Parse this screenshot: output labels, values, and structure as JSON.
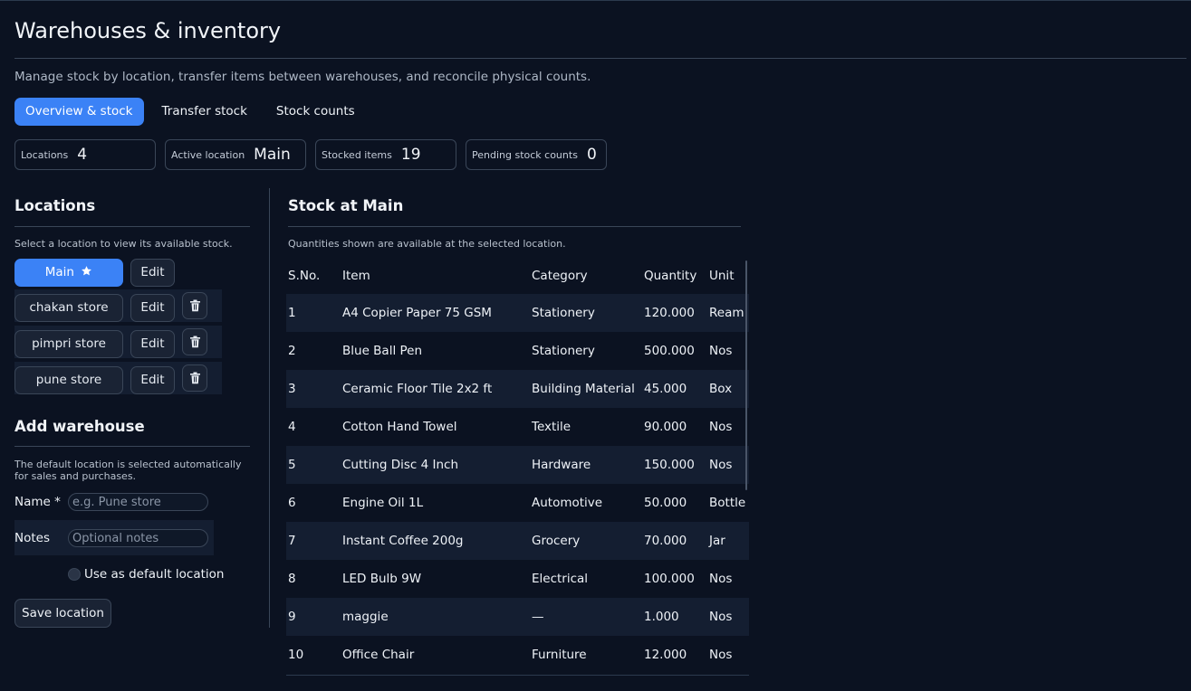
{
  "page": {
    "title": "Warehouses & inventory",
    "subtitle": "Manage stock by location, transfer items between warehouses, and reconcile physical counts."
  },
  "tabs": [
    {
      "label": "Overview & stock",
      "active": true
    },
    {
      "label": "Transfer stock",
      "active": false
    },
    {
      "label": "Stock counts",
      "active": false
    }
  ],
  "stats": [
    {
      "label": "Locations",
      "value": "4"
    },
    {
      "label": "Active location",
      "value": "Main"
    },
    {
      "label": "Stocked items",
      "value": "19"
    },
    {
      "label": "Pending stock counts",
      "value": "0"
    }
  ],
  "locations": {
    "title": "Locations",
    "hint": "Select a location to view its available stock.",
    "edit_label": "Edit",
    "items": [
      {
        "name": "Main",
        "default": true,
        "active": true
      },
      {
        "name": "chakan store",
        "default": false,
        "active": false
      },
      {
        "name": "pimpri store",
        "default": false,
        "active": false
      },
      {
        "name": "pune store",
        "default": false,
        "active": false
      }
    ]
  },
  "add_warehouse": {
    "title": "Add warehouse",
    "hint": "The default location is selected automatically for sales and purchases.",
    "name_label": "Name *",
    "name_placeholder": "e.g. Pune store",
    "notes_label": "Notes",
    "notes_placeholder": "Optional notes",
    "default_label": "Use as default location",
    "save_label": "Save location"
  },
  "stock": {
    "title": "Stock at Main",
    "hint": "Quantities shown are available at the selected location.",
    "columns": [
      "S.No.",
      "Item",
      "Category",
      "Quantity",
      "Unit"
    ],
    "rows": [
      [
        "1",
        "A4 Copier Paper 75 GSM",
        "Stationery",
        "120.000",
        "Ream"
      ],
      [
        "2",
        "Blue Ball Pen",
        "Stationery",
        "500.000",
        "Nos"
      ],
      [
        "3",
        "Ceramic Floor Tile 2x2 ft",
        "Building Material",
        "45.000",
        "Box"
      ],
      [
        "4",
        "Cotton Hand Towel",
        "Textile",
        "90.000",
        "Nos"
      ],
      [
        "5",
        "Cutting Disc 4 Inch",
        "Hardware",
        "150.000",
        "Nos"
      ],
      [
        "6",
        "Engine Oil 1L",
        "Automotive",
        "50.000",
        "Bottle"
      ],
      [
        "7",
        "Instant Coffee 200g",
        "Grocery",
        "70.000",
        "Jar"
      ],
      [
        "8",
        "LED Bulb 9W",
        "Electrical",
        "100.000",
        "Nos"
      ],
      [
        "9",
        "maggie",
        "—",
        "1.000",
        "Nos"
      ],
      [
        "10",
        "Office Chair",
        "Furniture",
        "12.000",
        "Nos"
      ]
    ]
  },
  "colors": {
    "background": "#0b1221",
    "accent": "#3b82f6",
    "row_shade": "#141e31",
    "border": "#3a4658"
  },
  "icons": {
    "default_marker": "star-icon",
    "delete": "trash-icon"
  }
}
